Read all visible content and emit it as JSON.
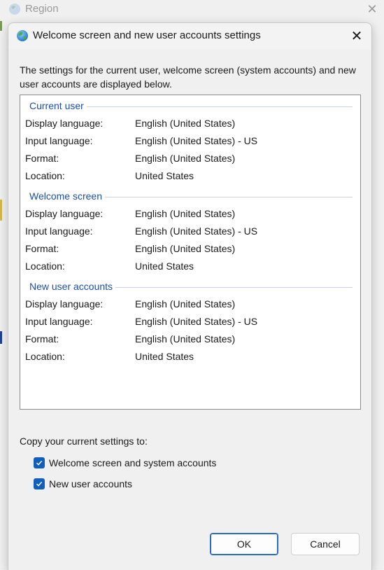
{
  "background_window": {
    "title": "Region"
  },
  "dialog": {
    "title": "Welcome screen and new user accounts settings",
    "description": "The settings for the current user, welcome screen (system accounts) and new user accounts are displayed below.",
    "groups": [
      {
        "header": "Current user",
        "rows": [
          {
            "label": "Display language:",
            "value": "English (United States)"
          },
          {
            "label": "Input language:",
            "value": "English (United States) - US"
          },
          {
            "label": "Format:",
            "value": "English (United States)"
          },
          {
            "label": "Location:",
            "value": "United States"
          }
        ]
      },
      {
        "header": "Welcome screen",
        "rows": [
          {
            "label": "Display language:",
            "value": "English (United States)"
          },
          {
            "label": "Input language:",
            "value": "English (United States) - US"
          },
          {
            "label": "Format:",
            "value": "English (United States)"
          },
          {
            "label": "Location:",
            "value": "United States"
          }
        ]
      },
      {
        "header": "New user accounts",
        "rows": [
          {
            "label": "Display language:",
            "value": "English (United States)"
          },
          {
            "label": "Input language:",
            "value": "English (United States) - US"
          },
          {
            "label": "Format:",
            "value": "English (United States)"
          },
          {
            "label": "Location:",
            "value": "United States"
          }
        ]
      }
    ],
    "copy_label": "Copy your current settings to:",
    "checkboxes": [
      {
        "label": "Welcome screen and system accounts",
        "checked": true
      },
      {
        "label": "New user accounts",
        "checked": true
      }
    ],
    "buttons": {
      "ok": "OK",
      "cancel": "Cancel"
    }
  },
  "icons": {
    "globe": "globe-icon",
    "close": "close-icon",
    "check": "checkmark-icon"
  },
  "colors": {
    "accent": "#0f5fbf",
    "group_header": "#1c4ea8"
  }
}
